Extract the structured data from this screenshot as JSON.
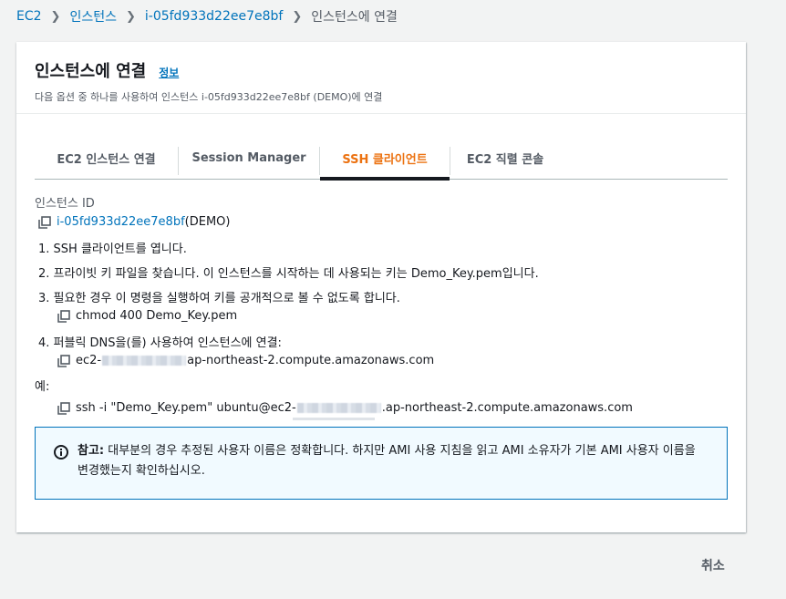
{
  "breadcrumb": {
    "items": [
      "EC2",
      "인스턴스",
      "i-05fd933d22ee7e8bf",
      "인스턴스에 연결"
    ]
  },
  "header": {
    "title": "인스턴스에 연결",
    "info_link": "정보",
    "description": "다음 옵션 중 하나를 사용하여 인스턴스 i-05fd933d22ee7e8bf (DEMO)에 연결"
  },
  "tabs": [
    {
      "label": "EC2 인스턴스 연결"
    },
    {
      "label": "Session Manager"
    },
    {
      "label": "SSH 클라이언트"
    },
    {
      "label": "EC2 직렬 콘솔"
    }
  ],
  "active_tab": "SSH 클라이언트",
  "content": {
    "instance_id_label": "인스턴스 ID",
    "instance_id": "i-05fd933d22ee7e8bf",
    "instance_name": " (DEMO)",
    "step1": "1. SSH 클라이언트를 엽니다.",
    "step2": "2. 프라이빗 키 파일을 찾습니다. 이 인스턴스를 시작하는 데 사용되는 키는 Demo_Key.pem입니다.",
    "step3": "3. 필요한 경우 이 명령을 실행하여 키를 공개적으로 볼 수 없도록 합니다.",
    "chmod_cmd": "chmod 400 Demo_Key.pem",
    "step4": "4. 퍼블릭 DNS을(를) 사용하여 인스턴스에 연결:",
    "dns_prefix": "ec2-",
    "dns_suffix": "ap-northeast-2.compute.amazonaws.com",
    "example_label": "예:",
    "ssh_prefix": "ssh -i \"Demo_Key.pem\" ubuntu@ec2-",
    "ssh_suffix": ".ap-northeast-2.compute.amazonaws.com"
  },
  "alert": {
    "title": "참고:",
    "text": " 대부분의 경우 추정된 사용자 이름은 정확합니다. 하지만 AMI 사용 지침을 읽고 AMI 소유자가 기본 AMI 사용자 이름을 변경했는지 확인하십시오."
  },
  "footer": {
    "cancel_label": "취소"
  },
  "colors": {
    "link": "#0073bb",
    "active_tab": "#ec7211",
    "alert_border": "#0073bb",
    "alert_bg": "#f1faff"
  }
}
